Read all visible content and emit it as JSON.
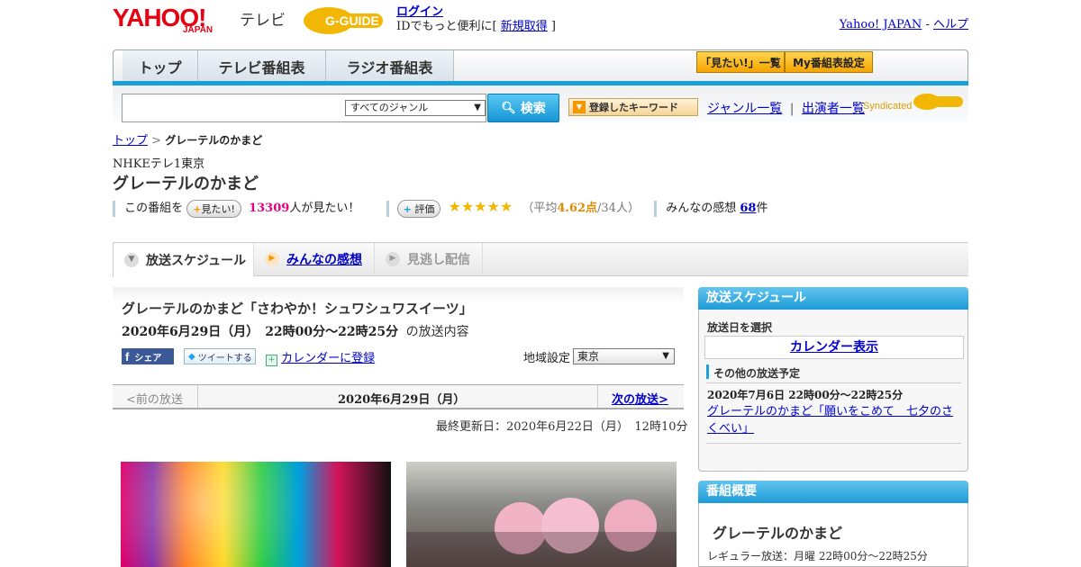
{
  "header": {
    "yahoo_logo": "YAHOO!",
    "yahoo_logo_sub": "JAPAN",
    "tv_label": "テレビ",
    "gguide_logo": "G-GUIDE",
    "login_label": "ログイン",
    "login_prefix": "IDでもっと便利に[ ",
    "signup_label": "新規取得",
    "login_suffix": " ]",
    "yahoo_japan_link": "Yahoo! JAPAN",
    "separator": " - ",
    "help_link": "ヘルプ"
  },
  "nav": {
    "tabs": [
      {
        "label": "トップ"
      },
      {
        "label": "テレビ番組表"
      },
      {
        "label": "ラジオ番組表"
      }
    ],
    "want_list_label": "「見たい!」一覧",
    "my_schedule_label": "My番組表設定"
  },
  "search": {
    "input_value": "",
    "genre_selected": "すべてのジャンル",
    "search_button": "検索",
    "keyword_button": "登録したキーワード",
    "genre_list_link": "ジャンル一覧",
    "divider": "|",
    "performer_list_link": "出演者一覧",
    "syndicated": "Syndicated"
  },
  "breadcrumb": {
    "top": "トップ",
    "sep": " > ",
    "current": "グレーテルのかまど"
  },
  "program": {
    "station": "NHKEテレ1東京",
    "title": "グレーテルのかまど",
    "want_prefix": "この番組を",
    "want_pill": "見たい!",
    "want_count": "13309",
    "want_suffix": "人が見たい！",
    "rating_pill": "評価",
    "stars": "★★★★★",
    "rating_open": "（平均",
    "rating_avg": "4.62点",
    "rating_close": "/34人）",
    "review_prefix": "みんなの感想",
    "review_count": "68",
    "review_suffix": "件"
  },
  "tabs": [
    {
      "label": "放送スケジュール"
    },
    {
      "label": "みんなの感想"
    },
    {
      "label": "見逃し配信"
    }
  ],
  "episode": {
    "title": "グレーテルのかまど「さわやか！シュワシュワスイーツ」",
    "date": "2020年6月29日（月）　22時00分～22時25分",
    "date_suffix": "の放送内容",
    "share_fb": "シェア",
    "share_tw": "ツイートする",
    "calendar_link": "カレンダーに登録",
    "region_label": "地域設定",
    "region_value": "東京",
    "prev_label": "<前の放送",
    "current_date": "2020年6月29日（月）",
    "next_label": "次の放送>",
    "updated": "最終更新日：2020年6月22日（月）　12時10分"
  },
  "sidebar": {
    "schedule_title": "放送スケジュール",
    "select_day": "放送日を選択",
    "calendar_display": "カレンダー表示",
    "other_title": "その他の放送予定",
    "other_date": "2020年7月6日  22時00分～22時25分",
    "other_link": "グレーテルのかまど「願いをこめて　七夕のさくべい」",
    "overview_title": "番組概要",
    "overview_name": "グレーテルのかまど",
    "regular": "レギュラー放送：月曜 22時00分～22時25分"
  },
  "colors": {
    "brand_red": "#e60012",
    "accent_blue": "#19a0d8",
    "want_pink": "#e6007e",
    "rating_orange": "#e08a00"
  }
}
